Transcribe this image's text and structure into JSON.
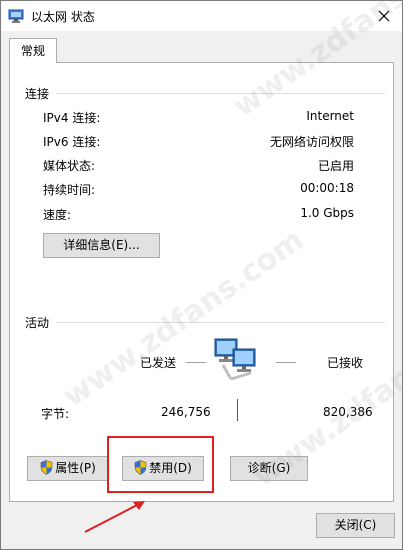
{
  "window": {
    "title": "以太网 状态",
    "close_glyph": "✕"
  },
  "tabs": [
    {
      "label": "常规"
    }
  ],
  "connection": {
    "heading": "连接",
    "rows": [
      {
        "label": "IPv4 连接:",
        "value": "Internet"
      },
      {
        "label": "IPv6 连接:",
        "value": "无网络访问权限"
      },
      {
        "label": "媒体状态:",
        "value": "已启用"
      },
      {
        "label": "持续时间:",
        "value": "00:00:18"
      },
      {
        "label": "速度:",
        "value": "1.0 Gbps"
      }
    ],
    "details_button": "详细信息(E)..."
  },
  "activity": {
    "heading": "活动",
    "sent_label": "已发送",
    "received_label": "已接收",
    "bytes_label": "字节:",
    "bytes_sent": "246,756",
    "bytes_received": "820,386"
  },
  "actions": {
    "properties_button": "属性(P)",
    "disable_button": "禁用(D)",
    "diagnose_button": "诊断(G)"
  },
  "footer": {
    "close_button": "关闭(C)"
  },
  "annotation": {
    "highlight_color": "#e02020"
  },
  "watermark": {
    "text": "www.zdfans.com"
  }
}
